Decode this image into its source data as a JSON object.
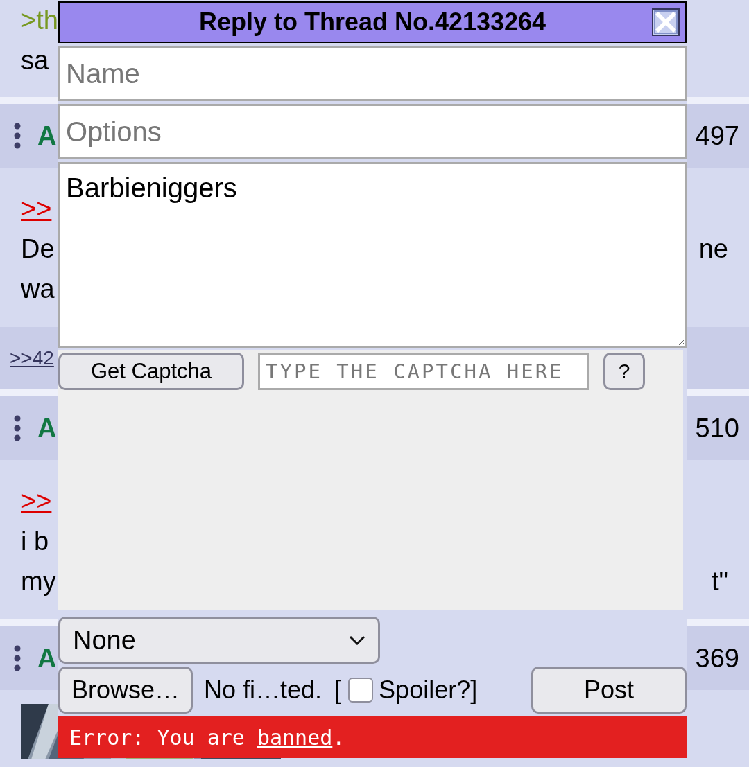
{
  "thread": [
    {
      "kind": "body",
      "lines": [
        {
          "kind": "quote",
          "text": ">th"
        },
        {
          "kind": "plain",
          "text": "sa"
        }
      ]
    },
    {
      "kind": "header",
      "name": "A",
      "number": "497"
    },
    {
      "kind": "body",
      "lines": [
        {
          "kind": "link",
          "text": ">>"
        },
        {
          "kind": "plain",
          "text": "De",
          "right": "ne"
        },
        {
          "kind": "plain",
          "text": "wa"
        }
      ]
    },
    {
      "kind": "backlinks",
      "text": ">>42"
    },
    {
      "kind": "header",
      "name": "A",
      "number": "510"
    },
    {
      "kind": "body",
      "lines": [
        {
          "kind": "link",
          "text": ">>"
        },
        {
          "kind": "plain",
          "text": "i b"
        },
        {
          "kind": "plain",
          "text": "my",
          "right": "t\""
        }
      ]
    },
    {
      "kind": "header",
      "name": "A",
      "number": "369"
    },
    {
      "kind": "media"
    }
  ],
  "reply_form": {
    "title": "Reply to Thread No.42133264",
    "name_field": {
      "placeholder": "Name"
    },
    "options_field": {
      "placeholder": "Options"
    },
    "comment_field": {
      "value": "Barbieniggers"
    },
    "captcha": {
      "button": "Get Captcha",
      "placeholder": "TYPE THE CAPTCHA HERE",
      "help": "?"
    },
    "select": {
      "value": "None"
    },
    "file": {
      "button": "Browse…",
      "status": "No fi…ted.",
      "bracket": "[",
      "spoiler_checked": false,
      "spoiler_label": "Spoiler?]"
    },
    "post_button": "Post",
    "error": {
      "prefix": "Error: You are ",
      "link": "banned",
      "suffix": "."
    }
  }
}
